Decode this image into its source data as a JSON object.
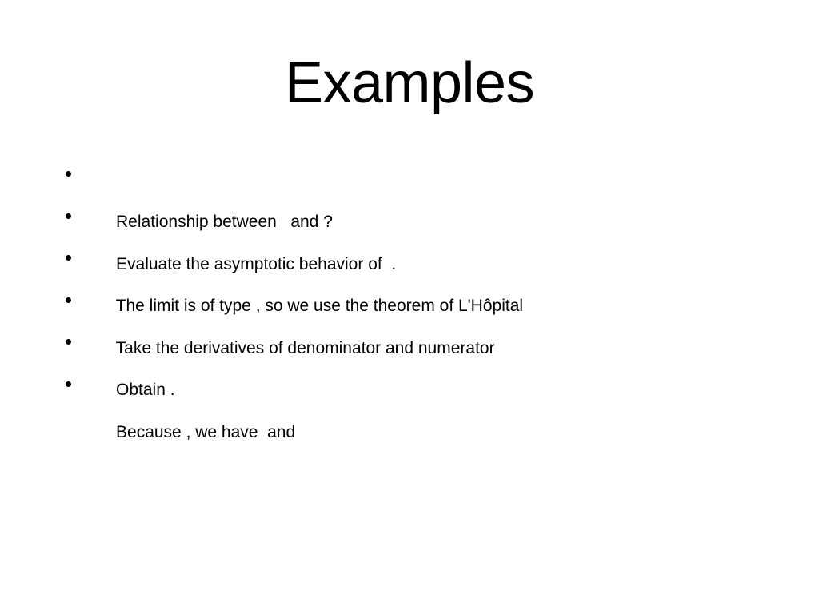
{
  "slide": {
    "title": "Examples",
    "background_color": "#ffffff",
    "text_color": "#000000",
    "bullet_marker": "bullet-dot",
    "bullets": [
      {
        "text": "Relationship between   and ?"
      },
      {
        "text": "Evaluate the asymptotic behavior of  ."
      },
      {
        "text": "The limit is of type , so we use the theorem of L'Hôpital"
      },
      {
        "text": "Take the derivatives of denominator and numerator"
      },
      {
        "text": "Obtain ."
      },
      {
        "text": "Because , we have  and"
      }
    ]
  }
}
